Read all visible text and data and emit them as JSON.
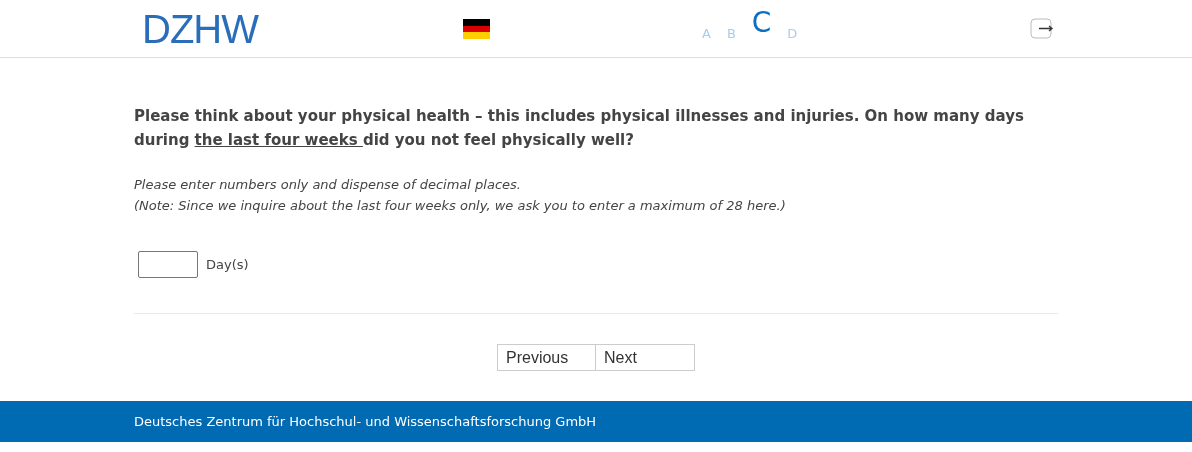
{
  "header": {
    "logo": "DZHW",
    "levels": [
      {
        "label": "A",
        "selected": false
      },
      {
        "label": "B",
        "selected": false
      },
      {
        "label": "C",
        "selected": true
      },
      {
        "label": "D",
        "selected": false
      }
    ]
  },
  "question": {
    "before": "Please think about your physical health – this includes physical illnesses and injuries. On how many days during ",
    "underlined": "the last four weeks ",
    "after": "did you not feel physically well?"
  },
  "instructions": [
    "Please enter numbers only and dispense of decimal places.",
    "(Note: Since we inquire about the last four weeks only, we ask you to enter a maximum of 28 here.)"
  ],
  "answer": {
    "unit": "Day(s)"
  },
  "buttons": [
    "Previous",
    "Next"
  ],
  "footer": "Deutsches Zentrum für Hochschul- und Wissenschaftsforschung GmbH"
}
